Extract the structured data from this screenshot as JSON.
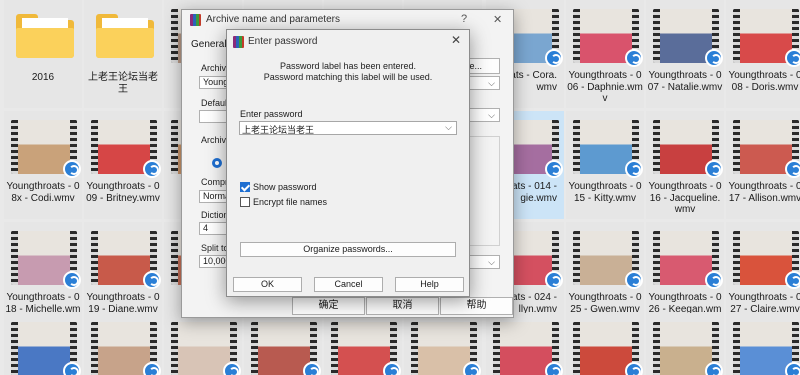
{
  "explorer": {
    "tiles": [
      {
        "caption": "2016",
        "type": "folder"
      },
      {
        "caption": "上老王论坛当老王",
        "type": "folder"
      },
      {
        "caption": "",
        "type": "video"
      },
      {
        "caption": "",
        "type": "video"
      },
      {
        "caption": "",
        "type": "video"
      },
      {
        "caption": "",
        "type": "video"
      },
      {
        "caption": "Youngthroats - 006 - Daphnie.wmv",
        "type": "video"
      },
      {
        "caption": "Youngthroats - 007 - Natalie.wmv",
        "type": "video"
      },
      {
        "caption": "Youngthroats - 008 - Doris.wmv",
        "type": "video"
      },
      {
        "caption": "Youngthroats - 08x - Codi.wmv",
        "type": "video"
      },
      {
        "caption": "Youngthroats - 009 - Britney.wmv",
        "type": "video"
      },
      {
        "caption": "Youngthroats - 015 - Kitty.wmv",
        "type": "video"
      },
      {
        "caption": "Youngthroats - 016 - Jacqueline.wmv",
        "type": "video"
      },
      {
        "caption": "Youngthroats - 017 - Allison.wmv",
        "type": "video"
      },
      {
        "caption": "Youngthroats - 018 - Michelle.wmv",
        "type": "video"
      },
      {
        "caption": "Youngthroats - 019 - Diane.wmv",
        "type": "video"
      },
      {
        "caption": "Youngthroats - 025 - Gwen.wmv",
        "type": "video"
      },
      {
        "caption": "Youngthroats - 026 - Keegan.wmv",
        "type": "video"
      },
      {
        "caption": "Youngthroats - 027 - Claire.wmv",
        "type": "video"
      }
    ],
    "partial_captions": {
      "c3r0a": "00",
      "c6r0": "gthroats - Cora.wmv",
      "c6r1": "gthroats - 014 - gie.wmv",
      "c6r2": "gthroats - 024 - llyn.wmv",
      "c2r1": "T",
      "c2r2": "02"
    }
  },
  "archive_dialog": {
    "title": "Archive name and parameters",
    "help_glyph": "?",
    "close_glyph": "✕",
    "tab_general": "General",
    "labels": [
      "Archive",
      "Default",
      "Archiv",
      "Compre",
      "Dictiona",
      "Split to"
    ],
    "values": [
      "Young",
      "Norma",
      "4",
      "10,000"
    ],
    "browse_btn": "se...",
    "combo_value": "",
    "ok": "确定",
    "cancel": "取消",
    "help": "帮助"
  },
  "password_dialog": {
    "title": "Enter password",
    "close_glyph": "✕",
    "info_line1": "Password label has been entered.",
    "info_line2": "Password matching this label will be used.",
    "field_label": "Enter password",
    "field_value": "上老王论坛当老王",
    "show_password": "Show password",
    "encrypt_names": "Encrypt file names",
    "organize": "Organize passwords...",
    "ok": "OK",
    "cancel": "Cancel",
    "help": "Help"
  },
  "colors": {
    "accent": "#1f6fd1",
    "selection": "#cce4f7",
    "folder": "#f0b93a"
  }
}
